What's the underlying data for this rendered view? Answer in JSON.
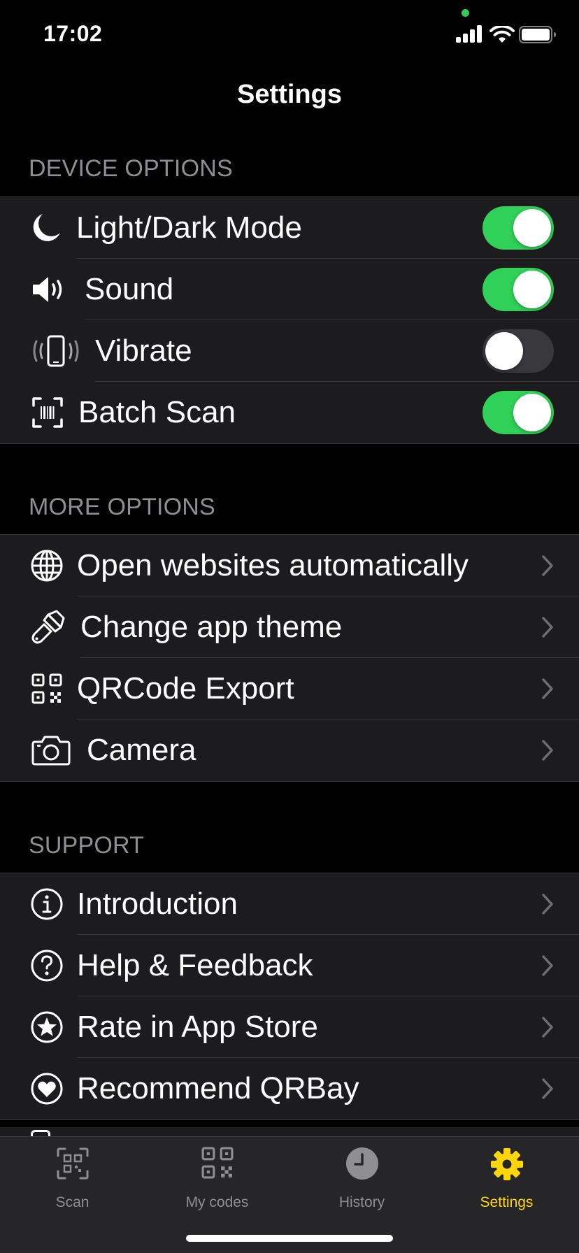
{
  "status_bar": {
    "time": "17:02"
  },
  "nav": {
    "title": "Settings"
  },
  "device_options": {
    "header": "DEVICE OPTIONS",
    "items": [
      {
        "label": "Light/Dark Mode",
        "icon": "moon-icon",
        "toggle_on": true
      },
      {
        "label": "Sound",
        "icon": "speaker-icon",
        "toggle_on": true
      },
      {
        "label": "Vibrate",
        "icon": "phone-vibrate-icon",
        "toggle_on": false
      },
      {
        "label": "Batch Scan",
        "icon": "barcode-scan-icon",
        "toggle_on": true
      }
    ]
  },
  "more_options": {
    "header": "MORE OPTIONS",
    "items": [
      {
        "label": "Open websites automatically",
        "icon": "globe-icon"
      },
      {
        "label": "Change app theme",
        "icon": "paintbrush-icon"
      },
      {
        "label": "QRCode Export",
        "icon": "qrcode-icon"
      },
      {
        "label": "Camera",
        "icon": "camera-icon"
      }
    ]
  },
  "support": {
    "header": "SUPPORT",
    "items": [
      {
        "label": "Introduction",
        "icon": "info-circle-icon"
      },
      {
        "label": "Help & Feedback",
        "icon": "question-circle-icon"
      },
      {
        "label": "Rate in App Store",
        "icon": "star-circle-icon"
      },
      {
        "label": "Recommend QRBay",
        "icon": "heart-circle-icon"
      }
    ]
  },
  "tab_bar": {
    "tabs": [
      {
        "label": "Scan",
        "icon": "scan-icon",
        "active": false
      },
      {
        "label": "My codes",
        "icon": "qrcode-icon",
        "active": false
      },
      {
        "label": "History",
        "icon": "clock-icon",
        "active": false
      },
      {
        "label": "Settings",
        "icon": "gear-icon",
        "active": true
      }
    ]
  },
  "colors": {
    "background": "#000000",
    "cell_background": "#1c1c1e",
    "toggle_on": "#30d158",
    "toggle_off": "#39393d",
    "accent": "#ffd60a",
    "secondary_text": "#8e8e93"
  }
}
